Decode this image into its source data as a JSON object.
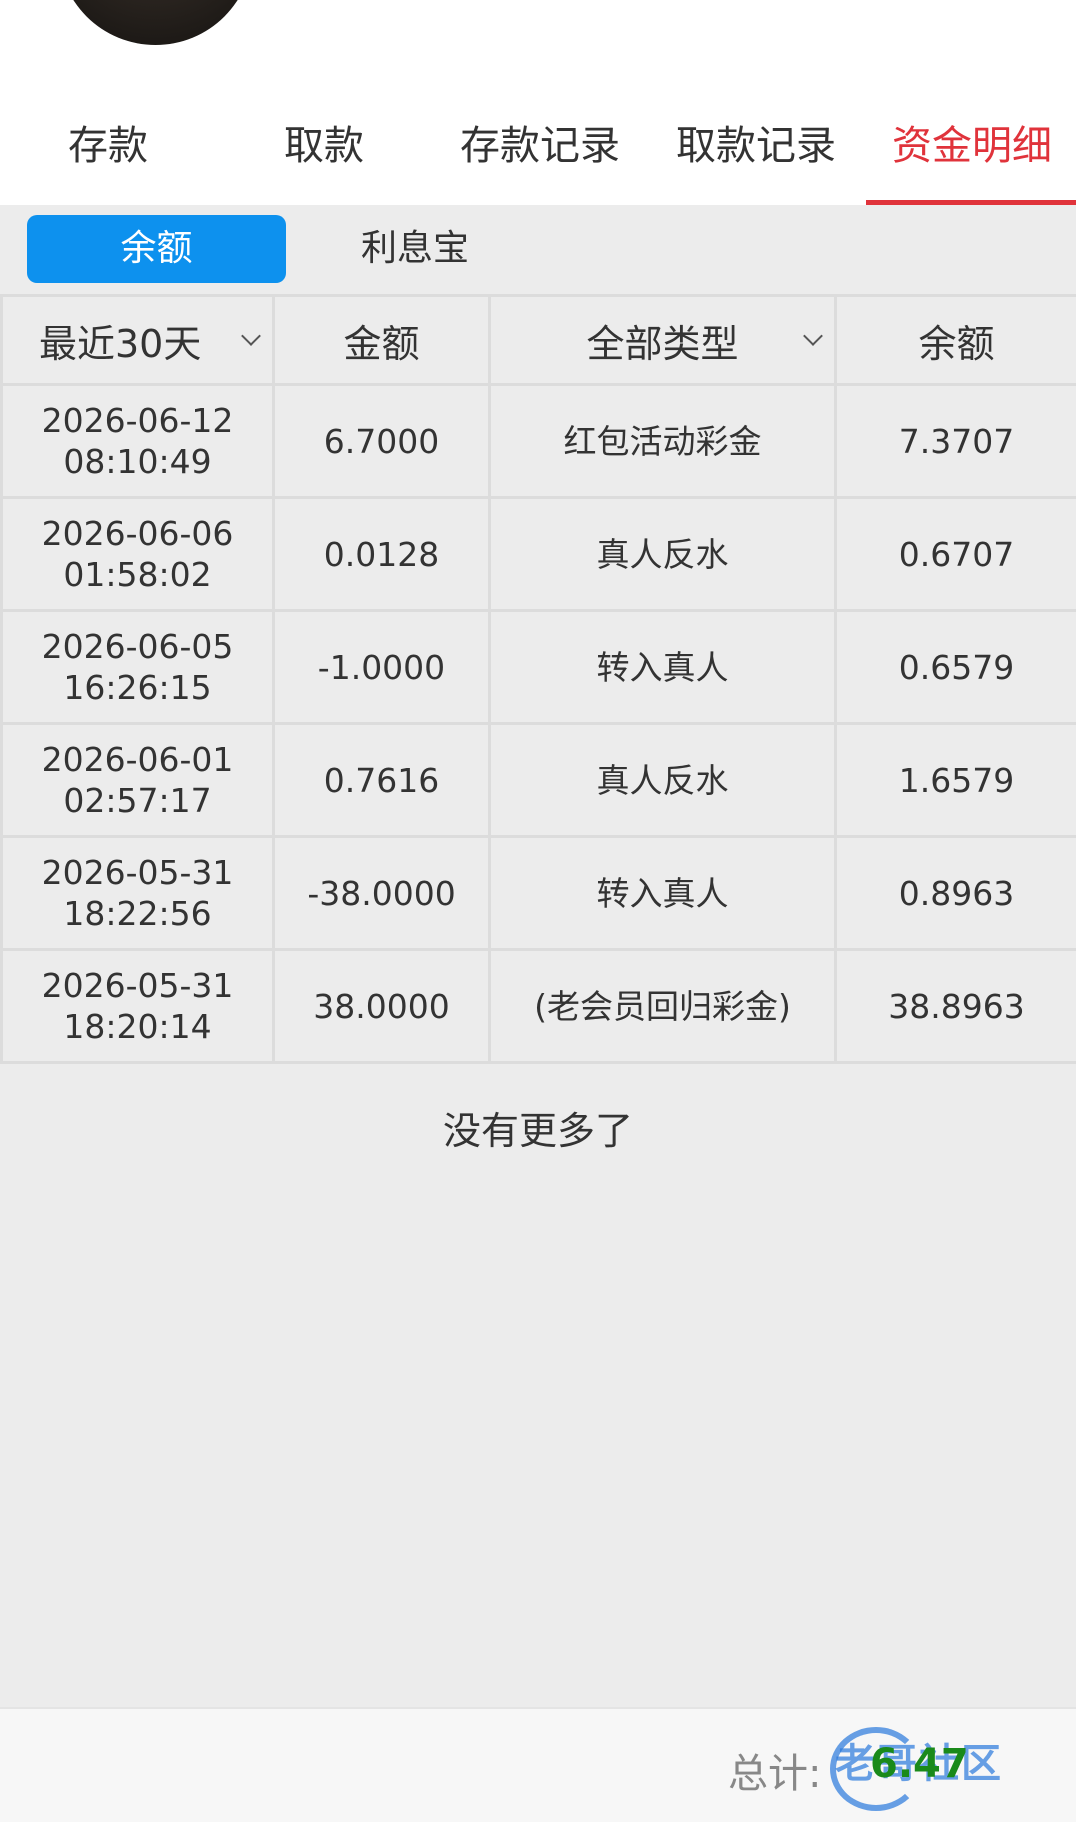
{
  "tabs": [
    {
      "label": "存款"
    },
    {
      "label": "取款"
    },
    {
      "label": "存款记录"
    },
    {
      "label": "取款记录"
    },
    {
      "label": "资金明细",
      "active": true
    }
  ],
  "subtabs": {
    "active": "余额",
    "other": "利息宝"
  },
  "table": {
    "headers": [
      "最近30天",
      "金额",
      "全部类型",
      "余额"
    ],
    "rows": [
      {
        "date": "2026-06-12",
        "time": "08:10:49",
        "amount": "6.7000",
        "type": "红包活动彩金",
        "balance": "7.3707"
      },
      {
        "date": "2026-06-06",
        "time": "01:58:02",
        "amount": "0.0128",
        "type": "真人反水",
        "balance": "0.6707"
      },
      {
        "date": "2026-06-05",
        "time": "16:26:15",
        "amount": "-1.0000",
        "type": "转入真人",
        "balance": "0.6579"
      },
      {
        "date": "2026-06-01",
        "time": "02:57:17",
        "amount": "0.7616",
        "type": "真人反水",
        "balance": "1.6579"
      },
      {
        "date": "2026-05-31",
        "time": "18:22:56",
        "amount": "-38.0000",
        "type": "转入真人",
        "balance": "0.8963"
      },
      {
        "date": "2026-05-31",
        "time": "18:20:14",
        "amount": "38.0000",
        "type": "(老会员回归彩金)",
        "balance": "38.8963"
      }
    ]
  },
  "no_more_text": "没有更多了",
  "footer": {
    "total_label": "总计:",
    "total_value": "6.47",
    "watermark": "老哥社区"
  },
  "colors": {
    "accent_red": "#e0333b",
    "accent_blue": "#0d91ee",
    "total_green": "#1a8a1a"
  }
}
